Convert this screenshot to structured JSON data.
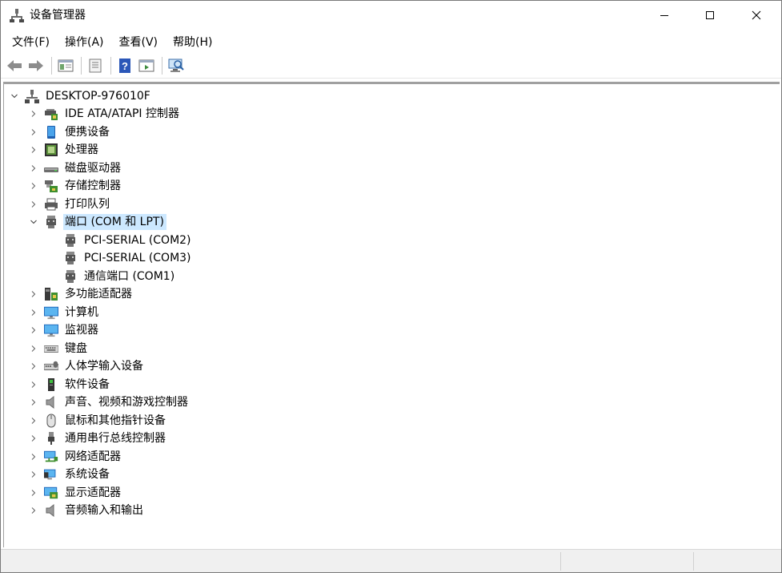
{
  "window": {
    "title": "设备管理器"
  },
  "menu": [
    "文件(F)",
    "操作(A)",
    "查看(V)",
    "帮助(H)"
  ],
  "toolbar": [
    "back-icon",
    "forward-icon",
    "properties-panel-icon",
    "properties-icon",
    "help-icon",
    "update-driver-icon",
    "scan-hardware-icon"
  ],
  "tree": {
    "root": "DESKTOP-976010F",
    "categories": [
      {
        "label": "IDE ATA/ATAPI 控制器",
        "icon": "ide-controller-icon"
      },
      {
        "label": "便携设备",
        "icon": "portable-device-icon"
      },
      {
        "label": "处理器",
        "icon": "processor-icon"
      },
      {
        "label": "磁盘驱动器",
        "icon": "disk-drive-icon"
      },
      {
        "label": "存储控制器",
        "icon": "storage-controller-icon"
      },
      {
        "label": "打印队列",
        "icon": "printer-icon"
      },
      {
        "label": "端口 (COM 和 LPT)",
        "icon": "port-icon",
        "expanded": true,
        "selected": true,
        "children": [
          "PCI-SERIAL (COM2)",
          "PCI-SERIAL (COM3)",
          "通信端口 (COM1)"
        ]
      },
      {
        "label": "多功能适配器",
        "icon": "multifunction-adapter-icon"
      },
      {
        "label": "计算机",
        "icon": "computer-icon"
      },
      {
        "label": "监视器",
        "icon": "monitor-icon"
      },
      {
        "label": "键盘",
        "icon": "keyboard-icon"
      },
      {
        "label": "人体学输入设备",
        "icon": "hid-icon"
      },
      {
        "label": "软件设备",
        "icon": "software-device-icon"
      },
      {
        "label": "声音、视频和游戏控制器",
        "icon": "speaker-icon"
      },
      {
        "label": "鼠标和其他指针设备",
        "icon": "mouse-icon"
      },
      {
        "label": "通用串行总线控制器",
        "icon": "usb-icon"
      },
      {
        "label": "网络适配器",
        "icon": "network-adapter-icon"
      },
      {
        "label": "系统设备",
        "icon": "system-device-icon"
      },
      {
        "label": "显示适配器",
        "icon": "display-adapter-icon"
      },
      {
        "label": "音频输入和输出",
        "icon": "audio-io-icon"
      }
    ]
  }
}
